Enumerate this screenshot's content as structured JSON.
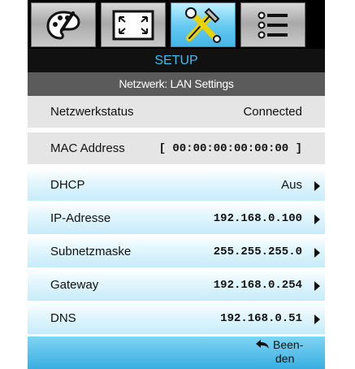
{
  "tabs": [
    {
      "icon": "palette-icon"
    },
    {
      "icon": "screen-fit-icon"
    },
    {
      "icon": "tools-icon",
      "active": true
    },
    {
      "icon": "list-menu-icon"
    }
  ],
  "title": "SETUP",
  "subtitle": "Netzwerk: LAN Settings",
  "rows": [
    {
      "label": "Netzwerkstatus",
      "value": "Connected"
    },
    {
      "label": "MAC Address",
      "value": "[ 00:00:00:00:00:00 ]"
    },
    {
      "label": "DHCP",
      "value": "Aus"
    },
    {
      "label": "IP-Adresse",
      "value": "192.168.0.100"
    },
    {
      "label": "Subnetzmaske",
      "value": "255.255.255.0"
    },
    {
      "label": "Gateway",
      "value": "192.168.0.254"
    },
    {
      "label": "DNS",
      "value": "192.168.0.51"
    }
  ],
  "exit": {
    "line1": "Been-",
    "line2": "den"
  },
  "colors": {
    "accent": "#3cc0ef",
    "selected_row": "#c6ecfa",
    "bottom_bar": "#3aaee0"
  }
}
